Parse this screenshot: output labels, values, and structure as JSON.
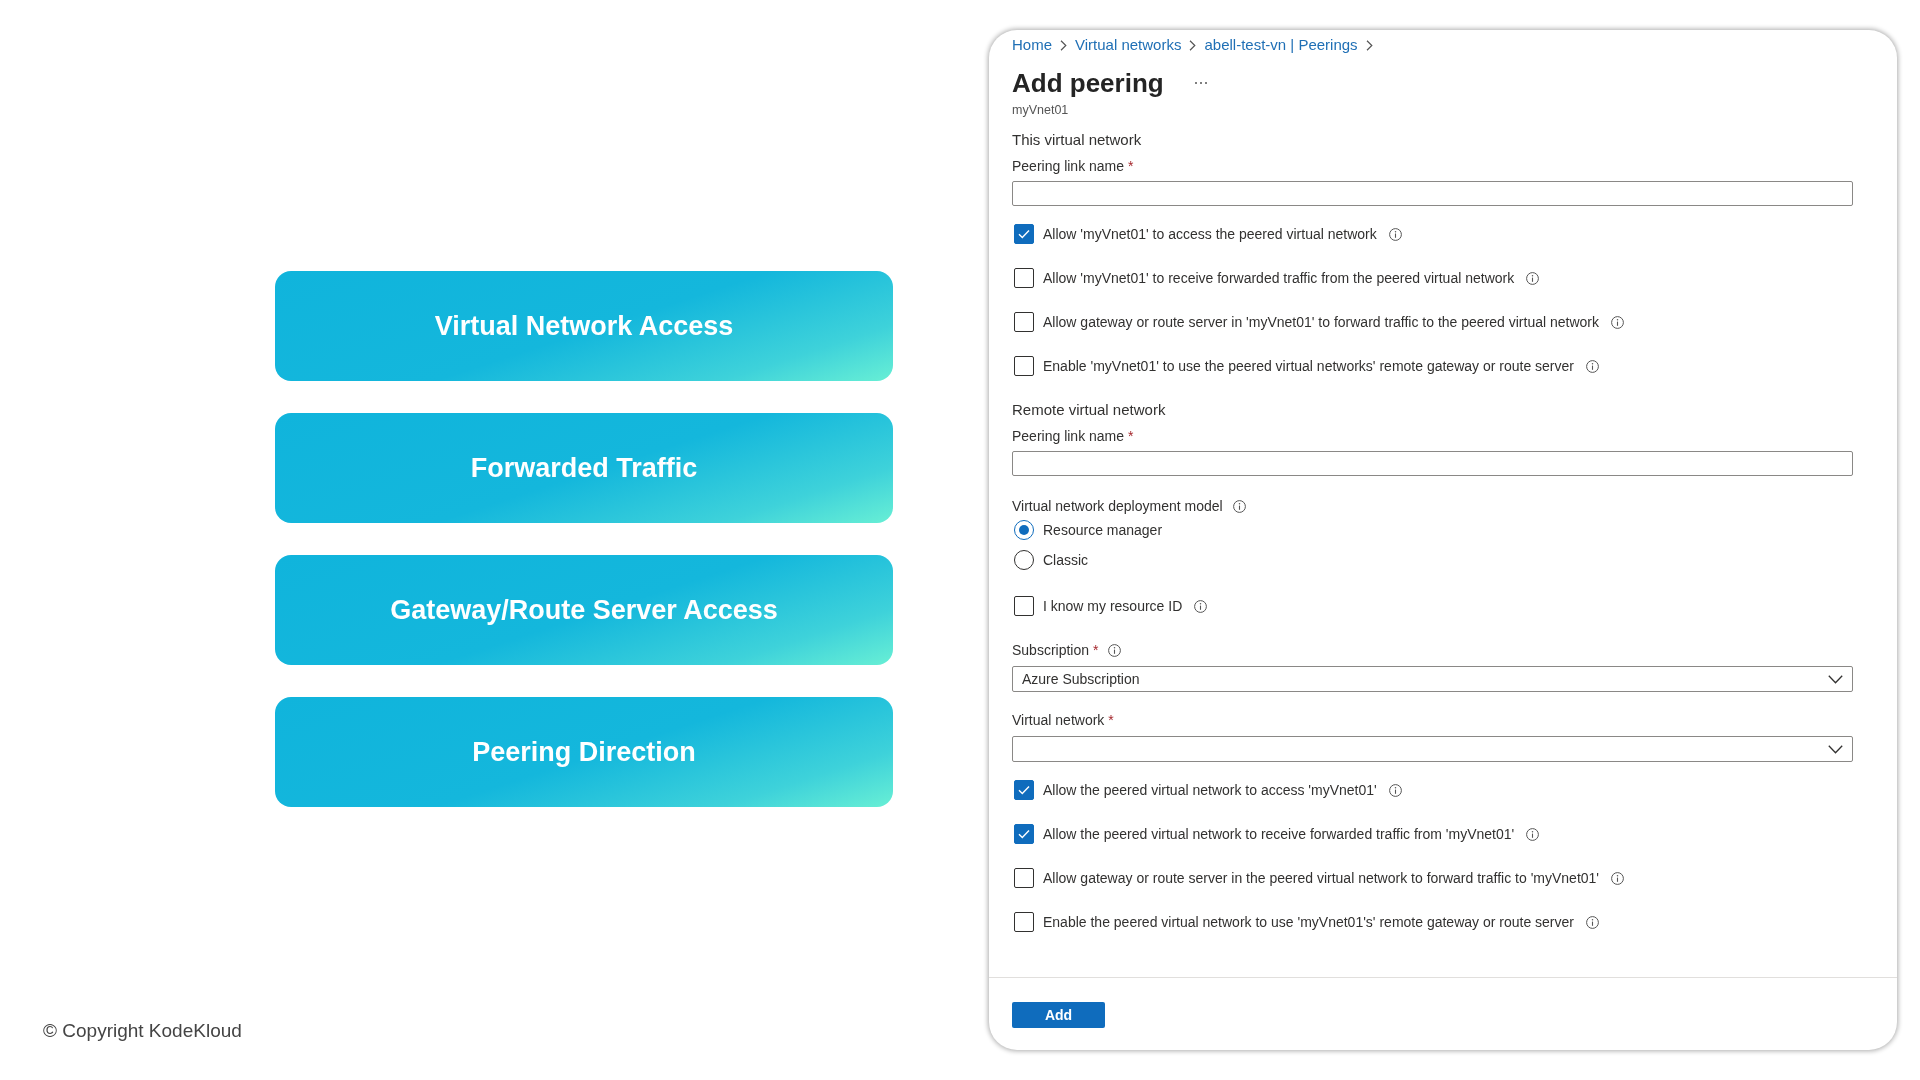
{
  "slide": {
    "cards": [
      {
        "label": "Virtual Network Access"
      },
      {
        "label": "Forwarded Traffic"
      },
      {
        "label": "Gateway/Route Server Access"
      },
      {
        "label": "Peering Direction"
      }
    ],
    "copyright": "© Copyright KodeKloud"
  },
  "panel": {
    "breadcrumb": [
      {
        "label": "Home"
      },
      {
        "label": "Virtual networks"
      },
      {
        "label": "abell-test-vn | Peerings"
      }
    ],
    "title": "Add peering",
    "subtitle": "myVnet01",
    "items": [
      {
        "kind": "heading",
        "label": "This virtual network",
        "info": false
      },
      {
        "kind": "text_field",
        "label": "Peering link name",
        "required_mark": "*",
        "info": false
      },
      {
        "kind": "checkbox",
        "label": "Allow 'myVnet01' to access the peered virtual network",
        "checked": true,
        "info": true
      },
      {
        "kind": "checkbox",
        "label": "Allow 'myVnet01' to receive forwarded traffic from the peered virtual network",
        "checked": false,
        "info": true
      },
      {
        "kind": "checkbox",
        "label": "Allow gateway or route server in 'myVnet01' to forward traffic to the peered virtual network",
        "checked": false,
        "info": true
      },
      {
        "kind": "checkbox",
        "label": "Enable 'myVnet01' to use the peered virtual networks' remote gateway or route server",
        "checked": false,
        "info": true
      },
      {
        "kind": "heading",
        "label": "Remote virtual network",
        "info": false
      },
      {
        "kind": "text_field",
        "label": "Peering link name",
        "required_mark": "*",
        "info": false
      },
      {
        "kind": "radio_group",
        "label": "Virtual network deployment model",
        "info": true,
        "options": [
          {
            "label": "Resource manager",
            "selected": true
          },
          {
            "label": "Classic",
            "selected": false
          }
        ]
      },
      {
        "kind": "checkbox",
        "label": "I know my resource ID",
        "checked": false,
        "info": true
      },
      {
        "kind": "dropdown",
        "label": "Subscription",
        "required_mark": "*",
        "info": true,
        "value": "Azure Subscription"
      },
      {
        "kind": "dropdown",
        "label": "Virtual network",
        "required_mark": "*",
        "info": false
      },
      {
        "kind": "checkbox",
        "label": "Allow the peered virtual network to access 'myVnet01'",
        "checked": true,
        "info": true
      },
      {
        "kind": "checkbox",
        "label": "Allow the peered virtual network to receive forwarded traffic from 'myVnet01'",
        "checked": true,
        "info": true
      },
      {
        "kind": "checkbox",
        "label": "Allow gateway or route server in the peered virtual network to forward traffic to 'myVnet01'",
        "checked": false,
        "info": true
      },
      {
        "kind": "checkbox",
        "label": "Enable the peered virtual network to use 'myVnet01's' remote gateway or route server",
        "checked": false,
        "info": true
      }
    ],
    "footer": {
      "button": "Add"
    }
  }
}
